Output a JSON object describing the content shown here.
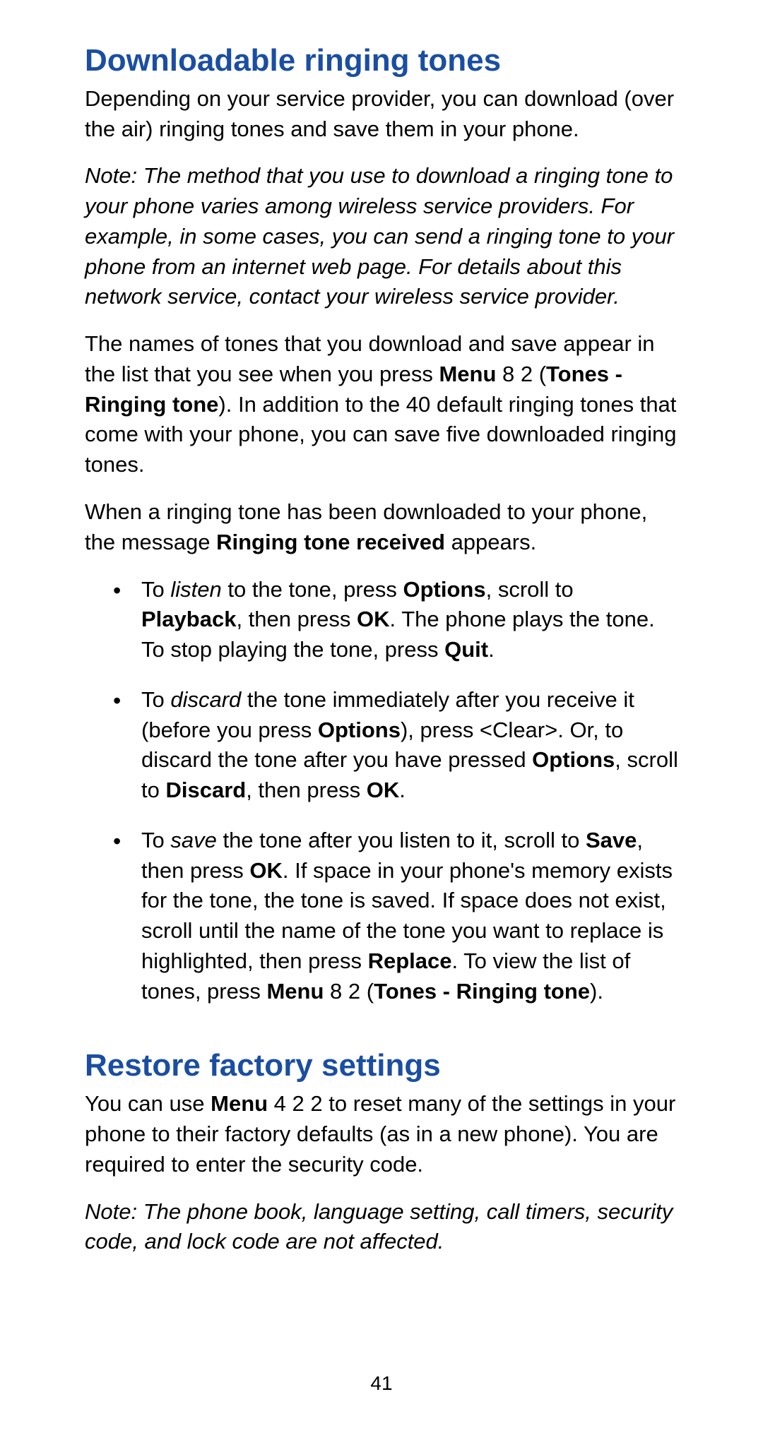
{
  "page_number": "41",
  "sections": {
    "downloadable": {
      "heading": "Downloadable ringing tones",
      "intro": "Depending on your service provider, you can download (over the air) ringing tones and save them in your phone.",
      "note": "Note: The method that you use to download a ringing tone to your phone varies among wireless service providers. For example, in some cases, you can send a ringing tone to your phone from an internet web page. For details about this network service, contact your wireless service provider.",
      "para3": {
        "r1": "The names of tones that you download and save appear in the list that you see when you press ",
        "menu": "Menu",
        "r2": " 8 2 (",
        "tones": "Tones - Ringing tone",
        "r3": "). In addition to the 40 default ringing tones that come with your phone, you can save five downloaded ringing tones."
      },
      "para4": {
        "r1": "When a ringing tone has been downloaded to your phone, the message ",
        "msg": "Ringing tone received",
        "r2": " appears."
      },
      "bullets": {
        "b1": {
          "r1": "To ",
          "listen": "listen",
          "r2": " to the tone, press ",
          "options": "Options",
          "r3": ", scroll to ",
          "playback": "Playback",
          "r4": ", then press ",
          "ok": "OK",
          "r5": ". The phone plays the tone. To stop playing the tone, press ",
          "quit": "Quit",
          "r6": "."
        },
        "b2": {
          "r1": "To ",
          "discard": "discard",
          "r2": " the tone immediately after you receive it (before you press ",
          "options": "Options",
          "r3": "), press <Clear>. Or, to discard the tone after you have pressed ",
          "options2": "Options",
          "r4": ", scroll to ",
          "discard2": "Discard",
          "r5": ", then press ",
          "ok": "OK",
          "r6": "."
        },
        "b3": {
          "r1": "To ",
          "save": "save",
          "r2": " the tone after you listen to it, scroll to ",
          "save2": "Save",
          "r3": ", then press ",
          "ok": "OK",
          "r4": ". If space in your phone's memory exists for the tone, the tone is saved. If space does not exist, scroll until the name of the tone you want to replace is highlighted, then press ",
          "replace": "Replace",
          "r5": ". To view the list of tones, press ",
          "menu": "Menu",
          "r6": " 8 2 (",
          "tones": "Tones - Ringing tone",
          "r7": ")."
        }
      }
    },
    "restore": {
      "heading": "Restore factory settings",
      "para1": {
        "r1": "You can use ",
        "menu": "Menu",
        "r2": " 4 2 2 to reset many of the settings in your phone to their factory defaults (as in a new phone). You are required to enter the security code."
      },
      "note": "Note:  The phone book, language setting, call timers, security code, and lock code are not affected."
    }
  }
}
